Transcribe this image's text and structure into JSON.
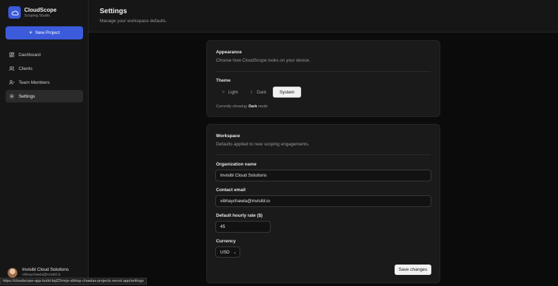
{
  "brand": {
    "title": "CloudScope",
    "subtitle": "Scoping Studio"
  },
  "sidebar": {
    "new_project_label": "New Project",
    "items": [
      {
        "label": "Dashboard",
        "icon": "dashboard-icon"
      },
      {
        "label": "Clients",
        "icon": "users-icon"
      },
      {
        "label": "Team Members",
        "icon": "team-icon"
      },
      {
        "label": "Settings",
        "icon": "gear-icon",
        "active": true
      }
    ],
    "user": {
      "name": "Invisibl Cloud Solutions",
      "email": "vibhaychawla@invisibl.io"
    }
  },
  "header": {
    "title": "Settings",
    "subtitle": "Manage your workspace defaults."
  },
  "appearance": {
    "title": "Appearance",
    "description": "Choose how CloudScope looks on your device.",
    "theme_label": "Theme",
    "options": {
      "light": "Light",
      "dark": "Dark",
      "system": "System"
    },
    "selected": "System",
    "status_prefix": "Currently showing:",
    "status_value": "Dark",
    "status_suffix": "mode"
  },
  "workspace": {
    "title": "Workspace",
    "description": "Defaults applied to new scoping engagements.",
    "org_label": "Organization name",
    "org_value": "Invisibl Cloud Solutions",
    "email_label": "Contact email",
    "email_value": "vibhaychawla@invisibl.io",
    "rate_label": "Default hourly rate ($)",
    "rate_value": "45",
    "currency_label": "Currency",
    "currency_value": "USD",
    "save_label": "Save changes"
  },
  "status_bar_url": "https://cloudscope-app-build-bqi22mnjx-vibhay-chawlas-projects.vercel.app/settings",
  "colors": {
    "accent": "#3b5bdb",
    "background": "#0b0b0b",
    "panel": "#1a1a1a"
  }
}
